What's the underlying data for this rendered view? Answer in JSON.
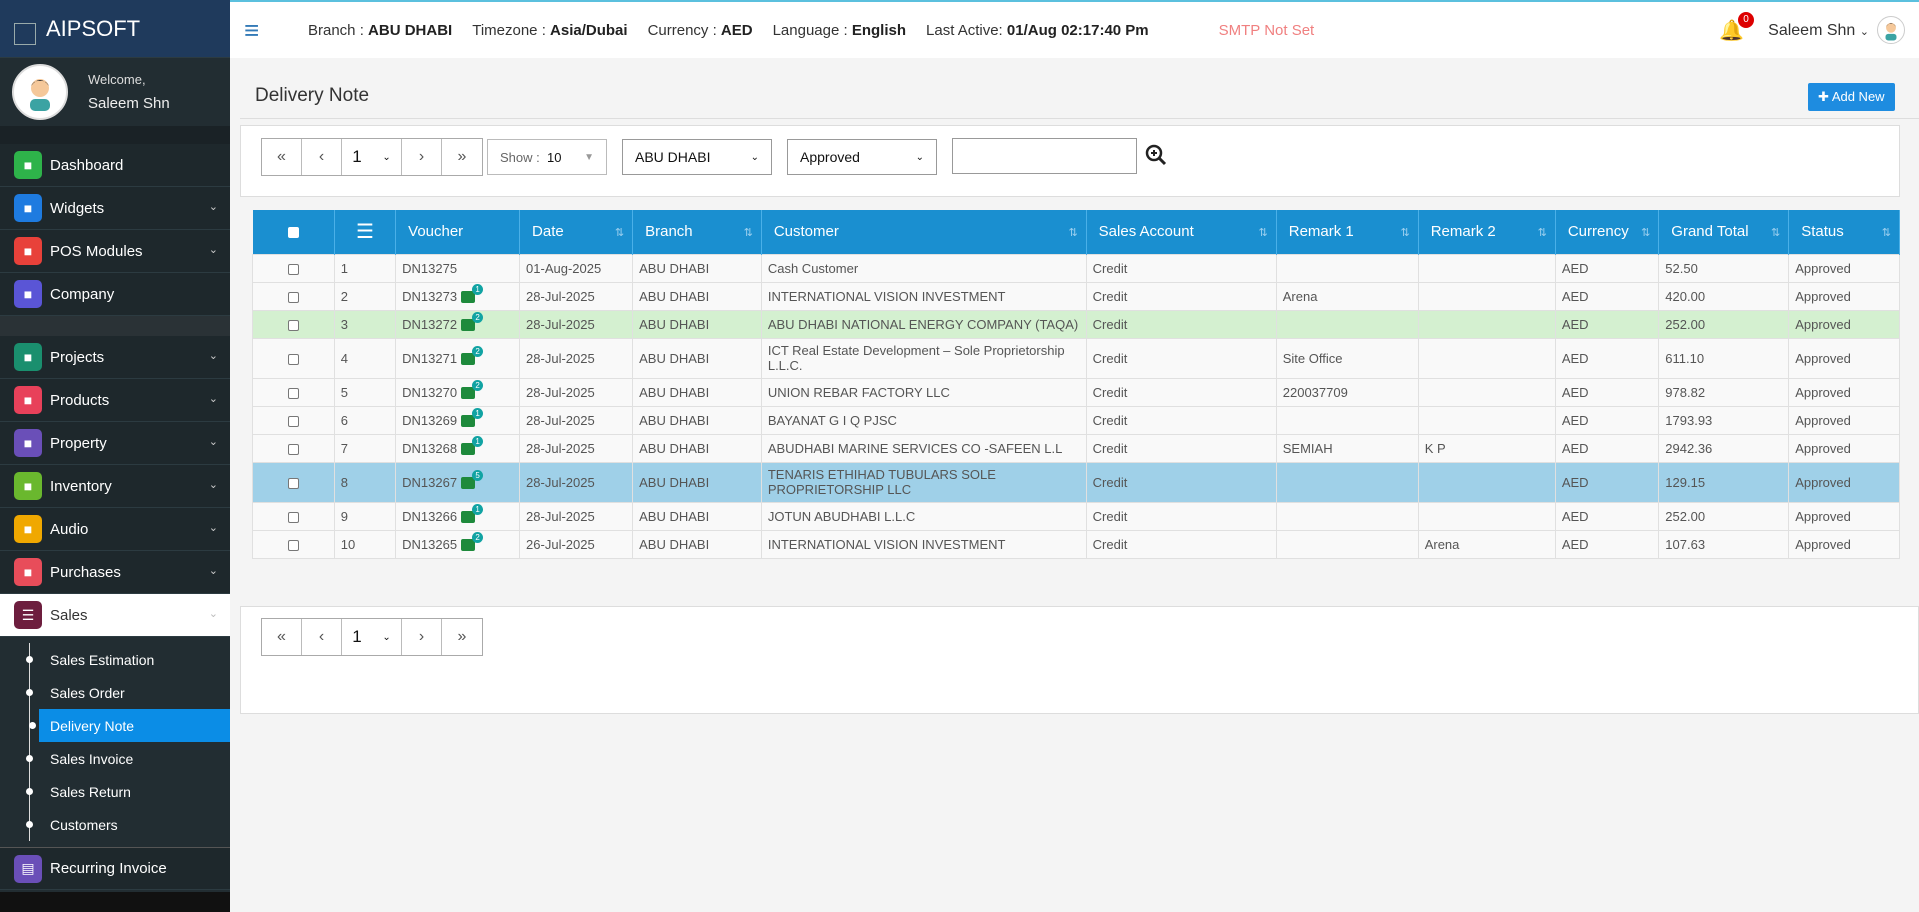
{
  "app": {
    "name": "AIPSOFT"
  },
  "user": {
    "welcome": "Welcome,",
    "name": "Saleem Shn"
  },
  "header": {
    "branch_label": "Branch :",
    "branch": "ABU DHABI",
    "tz_label": "Timezone :",
    "tz": "Asia/Dubai",
    "cur_label": "Currency :",
    "cur": "AED",
    "lang_label": "Language :",
    "lang": "English",
    "active_label": "Last Active:",
    "active": "01/Aug 02:17:40 Pm",
    "smtp": "SMTP Not Set",
    "notif_count": "0",
    "user_menu": "Saleem Shn"
  },
  "sidebar": {
    "group1": [
      {
        "label": "Dashboard",
        "icon": "dashboard-icon",
        "color": "#2eb34a"
      },
      {
        "label": "Widgets",
        "icon": "sliders-icon",
        "color": "#1e7be0",
        "chev": "⌄"
      },
      {
        "label": "POS Modules",
        "icon": "edit-icon",
        "color": "#e8413a",
        "chev": "⌄"
      },
      {
        "label": "Company",
        "icon": "building-icon",
        "color": "#5a55d6"
      }
    ],
    "group2": [
      {
        "label": "Projects",
        "icon": "projects-icon",
        "color": "#1a8f6e",
        "chev": "⌄"
      },
      {
        "label": "Products",
        "icon": "product-icon",
        "color": "#e8415a",
        "chev": "⌄"
      },
      {
        "label": "Property",
        "icon": "property-icon",
        "color": "#6a4fb8",
        "chev": "⌄"
      },
      {
        "label": "Inventory",
        "icon": "grid-icon",
        "color": "#6ab82e",
        "chev": "⌄"
      },
      {
        "label": "Audio",
        "icon": "mic-icon",
        "color": "#f0a800",
        "chev": "⌄"
      },
      {
        "label": "Purchases",
        "icon": "cart-icon",
        "color": "#e84d5a",
        "chev": "⌄"
      }
    ],
    "sales": {
      "label": "Sales",
      "icon": "sales-icon",
      "color": "#6d1e3e"
    },
    "sales_sub": [
      "Sales Estimation",
      "Sales Order",
      "Delivery Note",
      "Sales Invoice",
      "Sales Return",
      "Customers"
    ],
    "active_sub": "Delivery Note",
    "recurring": {
      "label": "Recurring Invoice",
      "icon": "recurring-icon",
      "color": "#6a4fb8"
    }
  },
  "page": {
    "title": "Delivery Note",
    "add_new": "Add New",
    "page_num": "1",
    "show_label": "Show :",
    "show_value": "10",
    "branch_filter": "ABU DHABI",
    "status_filter": "Approved"
  },
  "table": {
    "headers": [
      "Voucher",
      "Date",
      "Branch",
      "Customer",
      "Sales Account",
      "Remark 1",
      "Remark 2",
      "Currency",
      "Grand Total",
      "Status"
    ],
    "rows": [
      {
        "n": "1",
        "v": "DN13275",
        "b": "",
        "d": "01-Aug-2025",
        "br": "ABU DHABI",
        "c": "Cash Customer",
        "sa": "Credit",
        "r1": "",
        "r2": "",
        "cur": "AED",
        "gt": "52.50",
        "st": "Approved",
        "cls": ""
      },
      {
        "n": "2",
        "v": "DN13273",
        "b": "1",
        "d": "28-Jul-2025",
        "br": "ABU DHABI",
        "c": "INTERNATIONAL VISION INVESTMENT",
        "sa": "Credit",
        "r1": "Arena",
        "r2": "",
        "cur": "AED",
        "gt": "420.00",
        "st": "Approved",
        "cls": ""
      },
      {
        "n": "3",
        "v": "DN13272",
        "b": "2",
        "d": "28-Jul-2025",
        "br": "ABU DHABI",
        "c": "ABU DHABI NATIONAL ENERGY COMPANY (TAQA)",
        "sa": "Credit",
        "r1": "",
        "r2": "",
        "cur": "AED",
        "gt": "252.00",
        "st": "Approved",
        "cls": "r-green"
      },
      {
        "n": "4",
        "v": "DN13271",
        "b": "2",
        "d": "28-Jul-2025",
        "br": "ABU DHABI",
        "c": "ICT Real Estate Development – Sole Proprietorship L.L.C.",
        "sa": "Credit",
        "r1": "Site Office",
        "r2": "",
        "cur": "AED",
        "gt": "611.10",
        "st": "Approved",
        "cls": "tall"
      },
      {
        "n": "5",
        "v": "DN13270",
        "b": "2",
        "d": "28-Jul-2025",
        "br": "ABU DHABI",
        "c": "UNION REBAR FACTORY LLC",
        "sa": "Credit",
        "r1": "220037709",
        "r2": "",
        "cur": "AED",
        "gt": "978.82",
        "st": "Approved",
        "cls": ""
      },
      {
        "n": "6",
        "v": "DN13269",
        "b": "1",
        "d": "28-Jul-2025",
        "br": "ABU DHABI",
        "c": "BAYANAT G I Q PJSC",
        "sa": "Credit",
        "r1": "",
        "r2": "",
        "cur": "AED",
        "gt": "1793.93",
        "st": "Approved",
        "cls": ""
      },
      {
        "n": "7",
        "v": "DN13268",
        "b": "1",
        "d": "28-Jul-2025",
        "br": "ABU DHABI",
        "c": "ABUDHABI MARINE SERVICES CO -SAFEEN L.L",
        "sa": "Credit",
        "r1": "SEMIAH",
        "r2": "K P",
        "cur": "AED",
        "gt": "2942.36",
        "st": "Approved",
        "cls": ""
      },
      {
        "n": "8",
        "v": "DN13267",
        "b": "5",
        "d": "28-Jul-2025",
        "br": "ABU DHABI",
        "c": "TENARIS ETHIHAD TUBULARS SOLE PROPRIETORSHIP LLC",
        "sa": "Credit",
        "r1": "",
        "r2": "",
        "cur": "AED",
        "gt": "129.15",
        "st": "Approved",
        "cls": "r-blue tall"
      },
      {
        "n": "9",
        "v": "DN13266",
        "b": "1",
        "d": "28-Jul-2025",
        "br": "ABU DHABI",
        "c": "JOTUN ABUDHABI L.L.C",
        "sa": "Credit",
        "r1": "",
        "r2": "",
        "cur": "AED",
        "gt": "252.00",
        "st": "Approved",
        "cls": ""
      },
      {
        "n": "10",
        "v": "DN13265",
        "b": "2",
        "d": "26-Jul-2025",
        "br": "ABU DHABI",
        "c": "INTERNATIONAL VISION INVESTMENT",
        "sa": "Credit",
        "r1": "",
        "r2": "Arena",
        "cur": "AED",
        "gt": "107.63",
        "st": "Approved",
        "cls": ""
      }
    ]
  }
}
